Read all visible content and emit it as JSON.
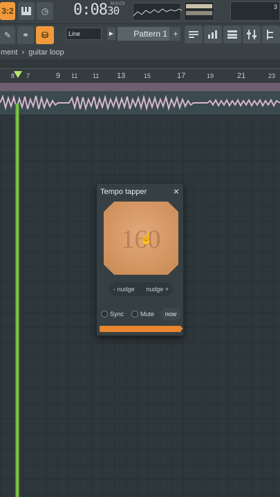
{
  "toolbar": {
    "beat_indicator": "3:2",
    "song_time_main": "0:08",
    "song_time_small": "30",
    "time_format_label": "M:S:CS",
    "snap_mode": "Line",
    "pattern_name": "Pattern 1",
    "add_pattern": "+",
    "counter_value": "3",
    "accent_color": "#f09a3c"
  },
  "breadcrumb": {
    "parent": "ment",
    "separator": "›",
    "current": "guitar loop"
  },
  "ruler": {
    "labels": [
      "8",
      "7",
      "9",
      "11",
      "13",
      "15",
      "17",
      "19",
      "21",
      "23"
    ],
    "big_labels": [
      "9",
      "13",
      "17",
      "21"
    ]
  },
  "dialog": {
    "title": "Tempo tapper",
    "close": "×",
    "tempo_value": "160",
    "nudge_minus": "- nudge",
    "nudge_plus": "nudge +",
    "sync_label": "Sync",
    "mute_label": "Mute",
    "now_label": "now",
    "progress_fraction": 0.97
  }
}
